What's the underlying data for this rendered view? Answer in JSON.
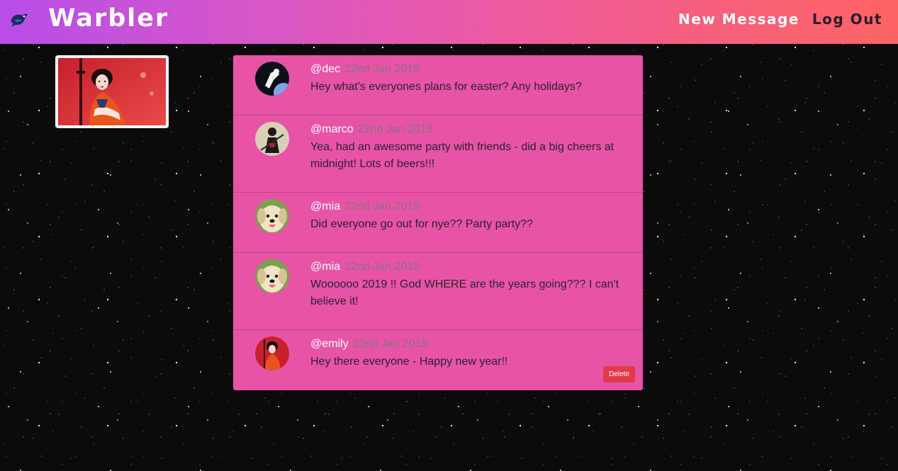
{
  "navbar": {
    "brand": "Warbler",
    "links": [
      {
        "label": "New Message"
      },
      {
        "label": "Log Out"
      }
    ]
  },
  "colors": {
    "message_bg": "#e754a6",
    "timestamp": "#8c6f82",
    "delete_button": "#e33a4a",
    "gradient_start": "#b64ee8",
    "gradient_end": "#ff6464"
  },
  "messages": [
    {
      "username": "@dec",
      "date": "22nd Jan 2019",
      "text": "Hey what's everyones plans for easter? Any holidays?",
      "avatar": "astronaut-avatar"
    },
    {
      "username": "@marco",
      "date": "22nd Jan 2019",
      "text": "Yea, had an awesome party with friends - did a big cheers at midnight! Lots of beers!!!",
      "avatar": "samurai-avatar"
    },
    {
      "username": "@mia",
      "date": "22nd Jan 2019",
      "text": "Did everyone go out for nye?? Party party??",
      "avatar": "puppy-avatar"
    },
    {
      "username": "@mia",
      "date": "22nd Jan 2019",
      "text": "Woooooo 2019 !! God WHERE are the years going??? I can't believe it!",
      "avatar": "puppy-avatar"
    },
    {
      "username": "@emily",
      "date": "22nd Jan 2019",
      "text": "Hey there everyone - Happy new year!!",
      "avatar": "geisha-avatar",
      "delete_label": "Delete"
    }
  ]
}
